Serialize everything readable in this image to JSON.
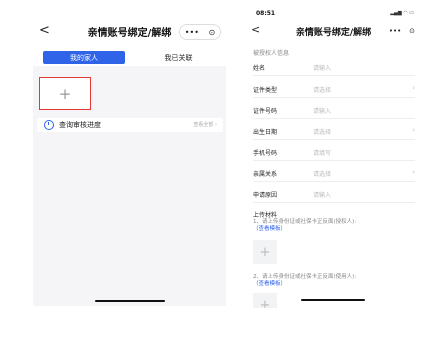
{
  "left": {
    "back_glyph": "<",
    "title": "亲情账号绑定/解绑",
    "more_glyph": "•••",
    "target_glyph": "⊙",
    "tabs": [
      "我的家人",
      "我已关联"
    ],
    "add_glyph": "+",
    "progress": {
      "label": "查询审核进度",
      "right": "查看全部 ›"
    }
  },
  "right": {
    "status_time": "08:51",
    "status_icons": "▂▄▆ ◠ ▭",
    "back_glyph": "<",
    "title": "亲情账号绑定/解绑",
    "more_glyph": "•••",
    "target_glyph": "⊙",
    "section_title": "被授权人信息",
    "fields": [
      {
        "label": "姓名",
        "placeholder": "请输入",
        "arrow": ""
      },
      {
        "label": "证件类型",
        "placeholder": "请选择",
        "arrow": "›"
      },
      {
        "label": "证件号码",
        "placeholder": "请输入",
        "arrow": ""
      },
      {
        "label": "出生日期",
        "placeholder": "请选择",
        "arrow": "›"
      },
      {
        "label": "手机号码",
        "placeholder": "请填写",
        "arrow": ""
      },
      {
        "label": "亲属关系",
        "placeholder": "请选择",
        "arrow": "›"
      },
      {
        "label": "申请原因",
        "placeholder": "请输入",
        "arrow": ""
      }
    ],
    "upload_title": "上传材料",
    "upload1_text": "1、请上传身份证或社保卡正反面(授权人):",
    "upload1_link": "（查看模板）",
    "upload2_text": "2、请上传身份证或社保卡正反面(使用人):",
    "upload2_link": "（查看模板）",
    "add_glyph": "+"
  },
  "colors": {
    "accent": "#2f64e9",
    "highlight": "#e53935"
  }
}
